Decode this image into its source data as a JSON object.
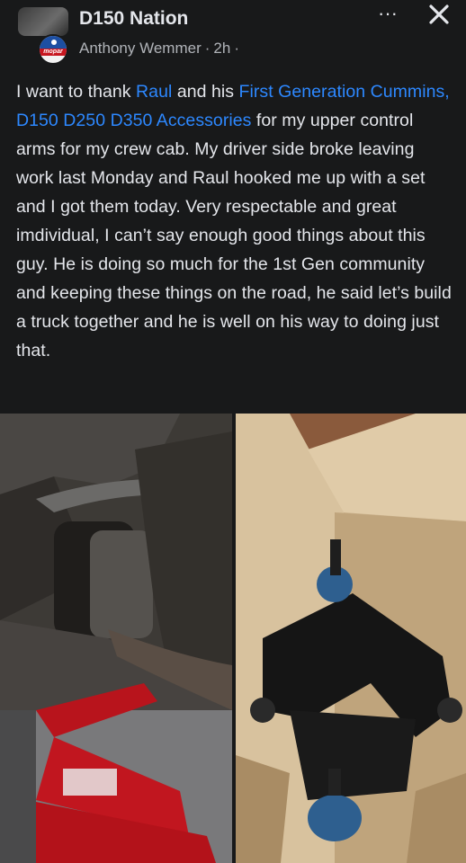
{
  "header": {
    "group_name": "D150 Nation",
    "author": "Anthony Wemmer",
    "time": "2h",
    "separator": "·",
    "privacy_icon": "globe-icon",
    "more_icon": "more-dots-icon",
    "close_icon": "close-icon",
    "more_label": "···"
  },
  "post": {
    "text_before_link1": "I want to thank ",
    "link1": "Raul",
    "text_between": " and his ",
    "link2": "First Generation Cummins, D150 D250 D350 Accessories",
    "text_after": " for my upper control arms for my crew cab. My driver side broke leaving work last Monday and Raul hooked me up with a set and I got them today. Very respectable and great imdividual, I can’t say enough good things about this guy. He is doing so much for the 1st Gen community and keeping these things on the road, he said let’s build a truck together and he is well on his way to doing just that."
  },
  "colors": {
    "background": "#18191a",
    "text": "#e4e6eb",
    "secondary_text": "#b0b3b8",
    "link": "#2d88ff"
  },
  "photos": [
    {
      "name": "broken-control-arm-photo"
    },
    {
      "name": "new-control-arm-in-box-photo"
    }
  ]
}
